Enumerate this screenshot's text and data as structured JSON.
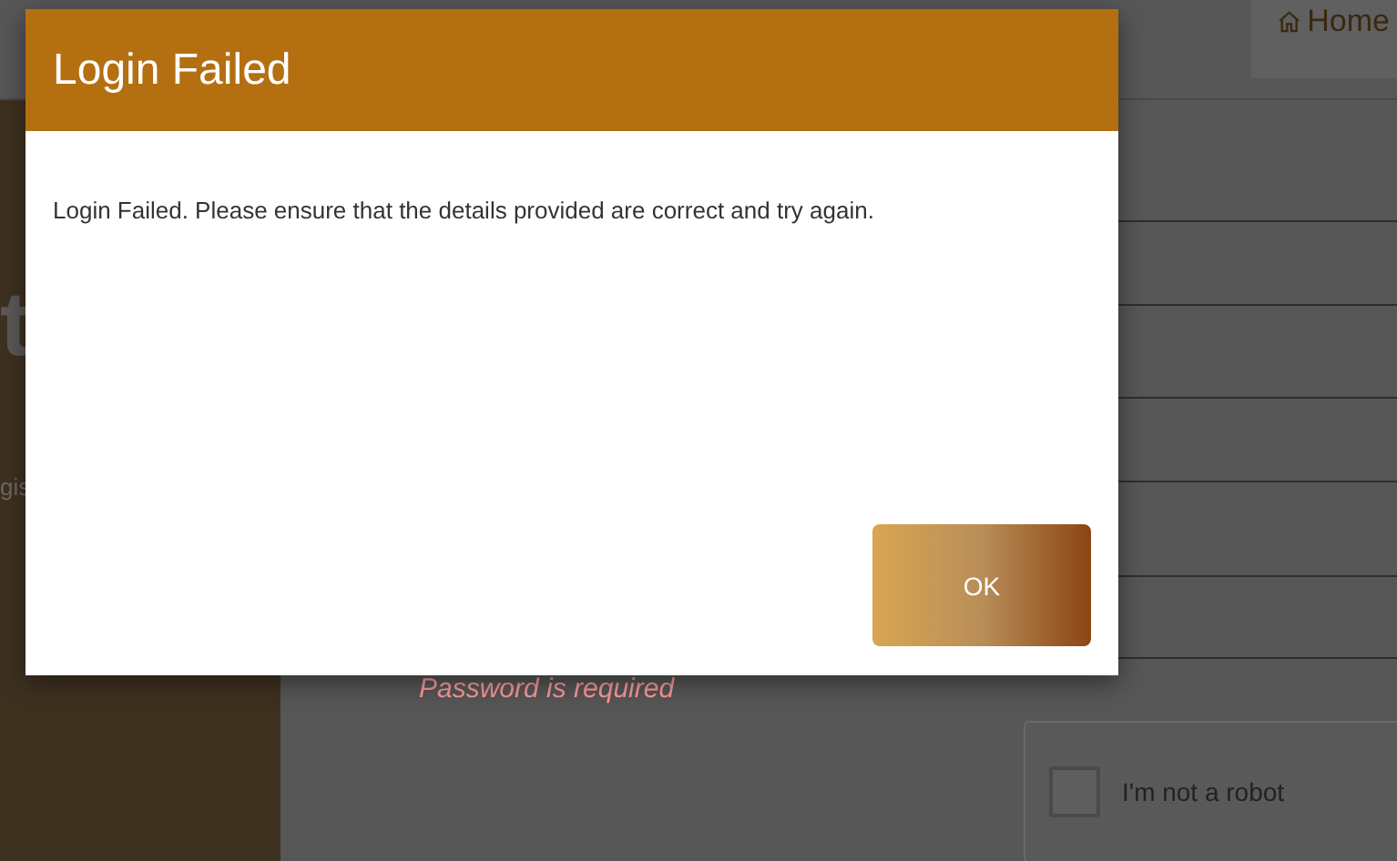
{
  "header": {
    "home_link": "Home"
  },
  "side_panel": {
    "heading_fragment": "t",
    "text_fragment": "gis"
  },
  "form": {
    "error": "Password is required"
  },
  "captcha": {
    "label": "I'm not a robot",
    "checked": false
  },
  "dialog": {
    "title": "Login Failed",
    "message": "Login Failed. Please ensure that the details provided are correct and try again.",
    "buttons": [
      {
        "label": "OK"
      }
    ]
  }
}
